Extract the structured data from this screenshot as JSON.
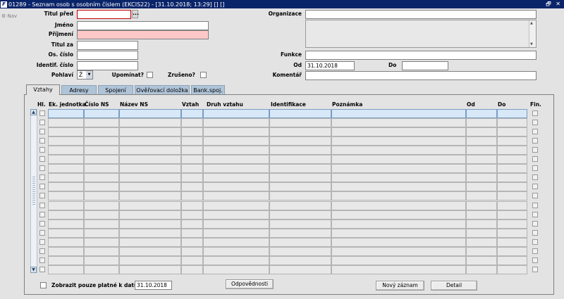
{
  "window": {
    "title": "01289 - Seznam osob s osobním číslem (EKCIS22) - [31.10.2018; 13:29]  [] []",
    "controls": "🗗 ✕"
  },
  "nav": {
    "label": "Nav"
  },
  "form": {
    "titul_pred": {
      "label": "Titul před",
      "value": "",
      "lov_label": "..."
    },
    "jmeno": {
      "label": "Jméno",
      "value": ""
    },
    "prijmeni": {
      "label": "Příjmení",
      "value": ""
    },
    "titul_za": {
      "label": "Titul za",
      "value": ""
    },
    "os_cislo": {
      "label": "Os. číslo",
      "value": ""
    },
    "identif_cislo": {
      "label": "Identif. číslo",
      "value": ""
    },
    "pohlavi": {
      "label": "Pohlaví",
      "value": "Ž"
    },
    "upominat": {
      "label": "Upomínat?"
    },
    "zruseno": {
      "label": "Zrušeno?"
    },
    "organizace": {
      "label": "Organizace",
      "value": ""
    },
    "funkce": {
      "label": "Funkce",
      "value": ""
    },
    "od": {
      "label": "Od",
      "value": "31.10.2018"
    },
    "do": {
      "label": "Do",
      "value": ""
    },
    "komentar": {
      "label": "Komentář",
      "value": ""
    }
  },
  "tabs": [
    "Vztahy",
    "Adresy",
    "Spojení",
    "Ověřovací doložka",
    "Bank.spoj."
  ],
  "grid": {
    "columns": [
      "Hl.",
      "Ek. jednotka",
      "Číslo NS",
      "Název NS",
      "Vztah",
      "Druh vztahu",
      "Identifikace",
      "Poznámka",
      "Od",
      "Do",
      "Fin."
    ],
    "row_count": 18
  },
  "footer": {
    "platne_label": "Zobrazit pouze platné k datu :",
    "platne_date": "31.10.2018",
    "odpovednosti": "Odpovědnosti",
    "novy_zaznam": "Nový záznam",
    "detail": "Detail"
  }
}
